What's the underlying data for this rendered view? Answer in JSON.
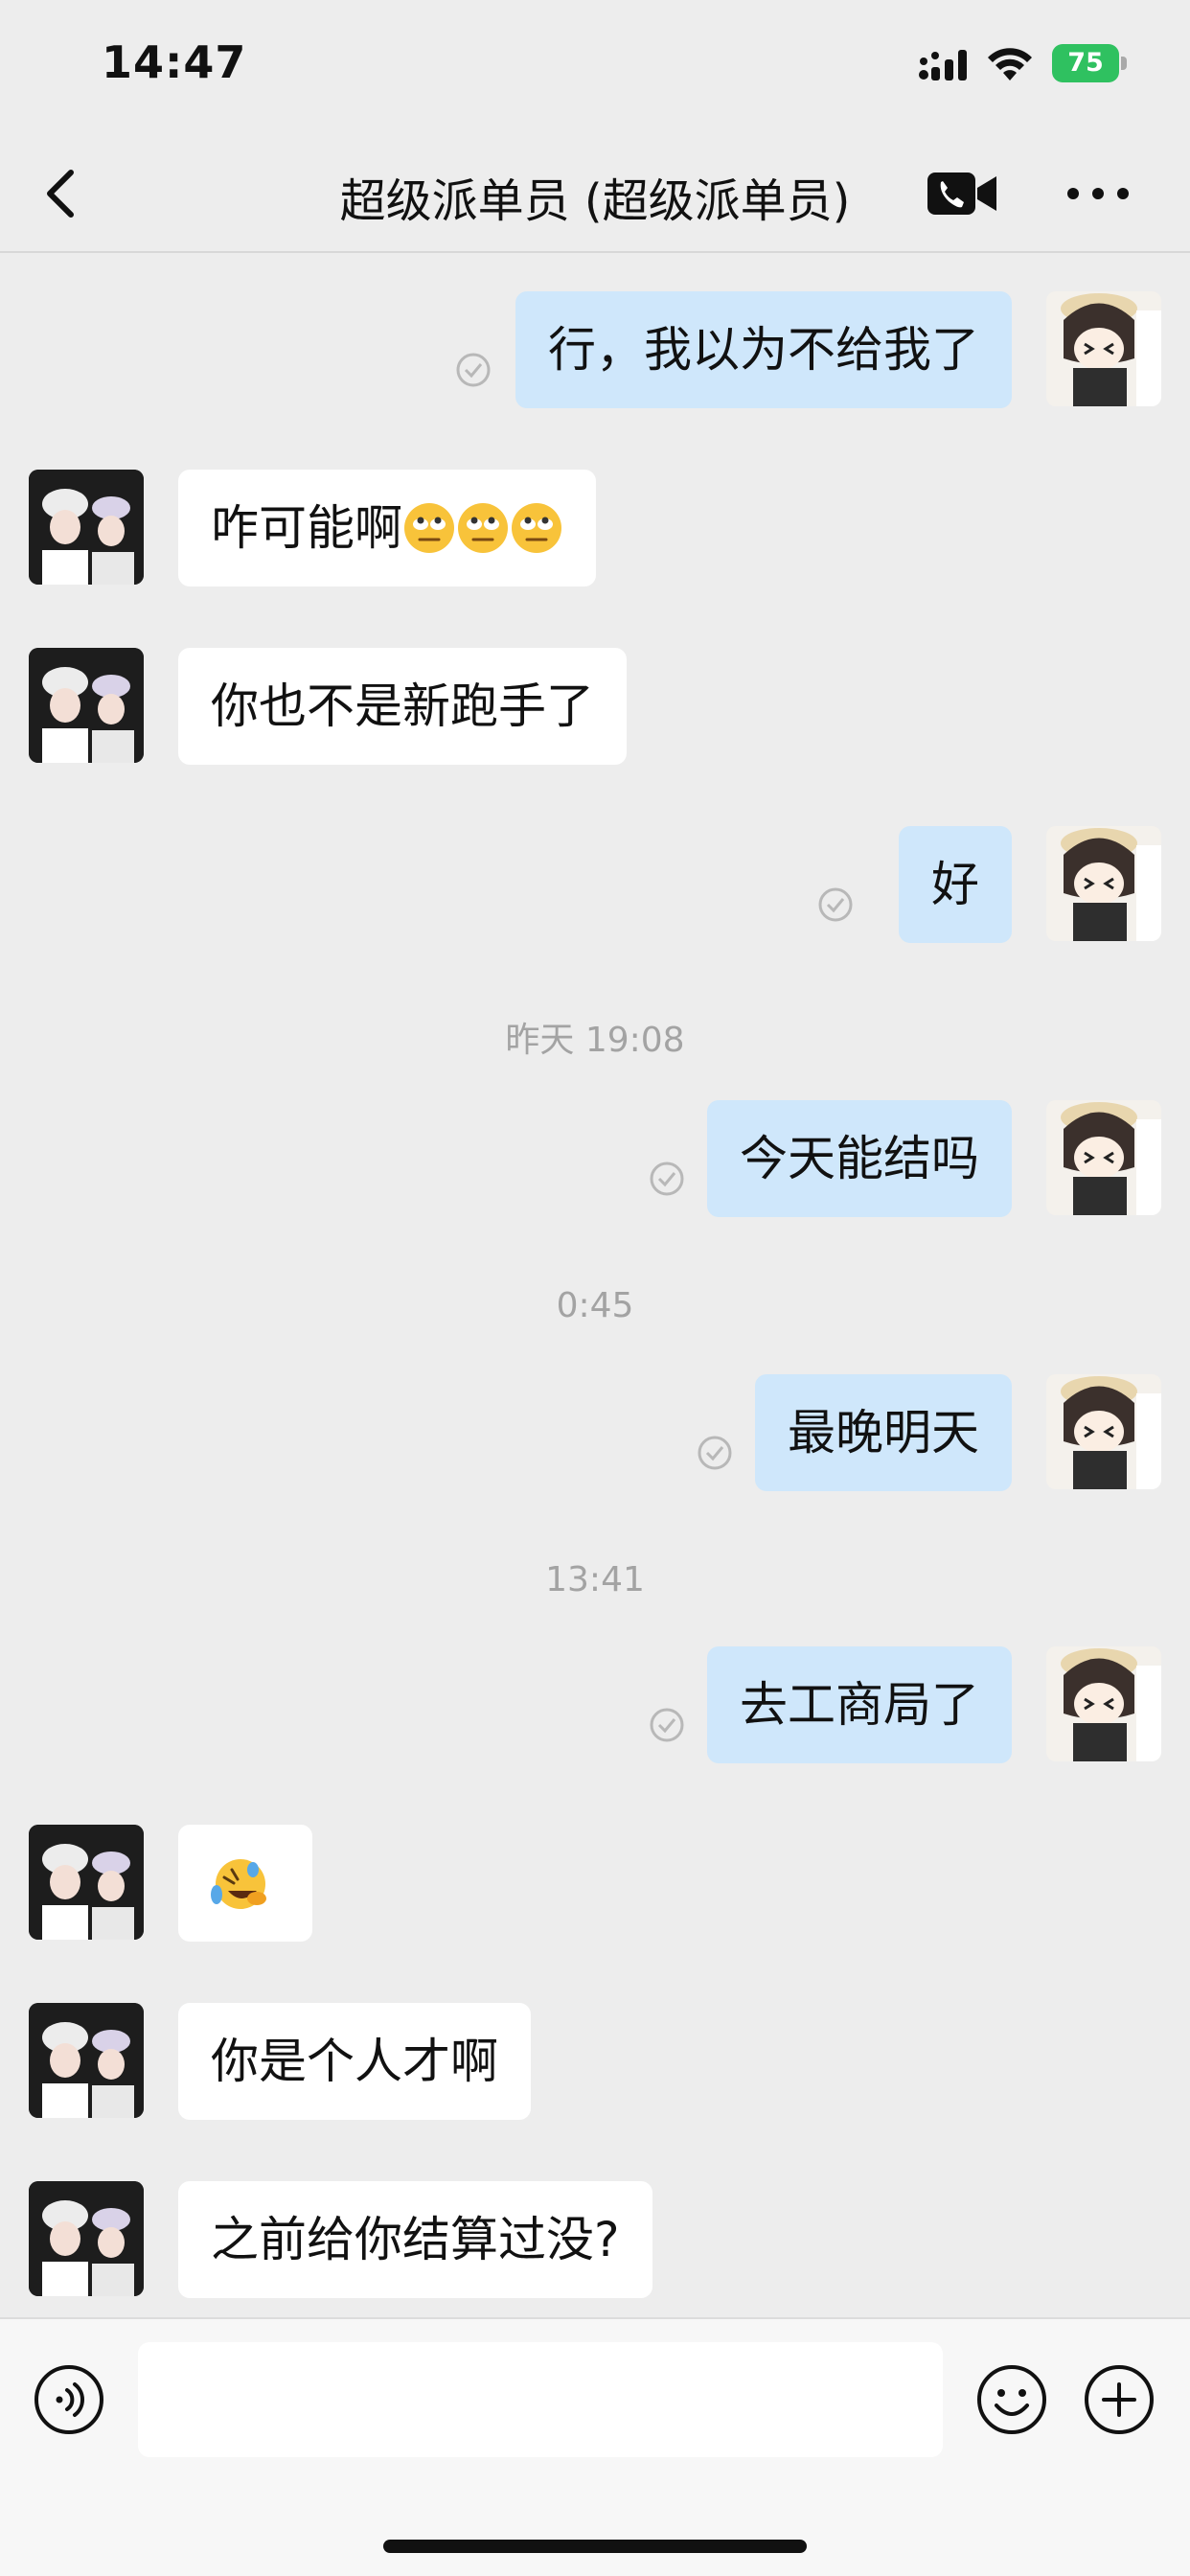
{
  "status_bar": {
    "time": "14:47",
    "battery": "75"
  },
  "header": {
    "title": "超级派单员 (超级派单员)"
  },
  "messages": [
    {
      "text": "行，我以为不给我了"
    },
    {
      "text": "咋可能啊"
    },
    {
      "text": "你也不是新跑手了"
    },
    {
      "text": "好"
    },
    {
      "time": "昨天 19:08"
    },
    {
      "text": "今天能结吗"
    },
    {
      "time": "0:45"
    },
    {
      "text": "最晚明天"
    },
    {
      "time": "13:41"
    },
    {
      "text": "去工商局了"
    },
    {
      "text": "你是个人才啊"
    },
    {
      "text": "之前给你结算过没?"
    }
  ],
  "icons": {
    "rolling_eyes": "rolling-eyes-emoji",
    "crying_laughing": "rolling-on-floor-laughing-emoji"
  },
  "colors": {
    "background": "#ededed",
    "self_bubble": "#cfe7fb",
    "other_bubble": "#ffffff",
    "battery": "#2fc160"
  }
}
